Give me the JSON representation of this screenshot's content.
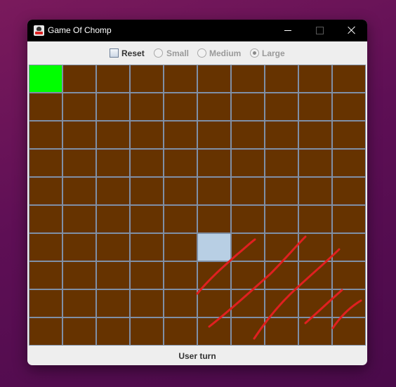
{
  "window": {
    "title": "Game Of Chomp",
    "icon": "chomp-app-icon"
  },
  "controls": {
    "reset_label": "Reset",
    "reset_checked": false,
    "size_options": [
      {
        "label": "Small",
        "selected": false,
        "enabled": false
      },
      {
        "label": "Medium",
        "selected": false,
        "enabled": false
      },
      {
        "label": "Large",
        "selected": true,
        "enabled": false
      }
    ]
  },
  "board": {
    "rows": 10,
    "cols": 10,
    "colors": {
      "cell": "#663300",
      "poison": "#00ff00",
      "hover": "#b8cfe4",
      "grid": "#7f8fa6"
    },
    "poison_cell": {
      "row": 0,
      "col": 0
    },
    "highlighted_cell": {
      "row": 6,
      "col": 5
    }
  },
  "annotation": {
    "color": "#e02020",
    "description_icon": "red-scribble-marks"
  },
  "status": {
    "text": "User turn"
  }
}
